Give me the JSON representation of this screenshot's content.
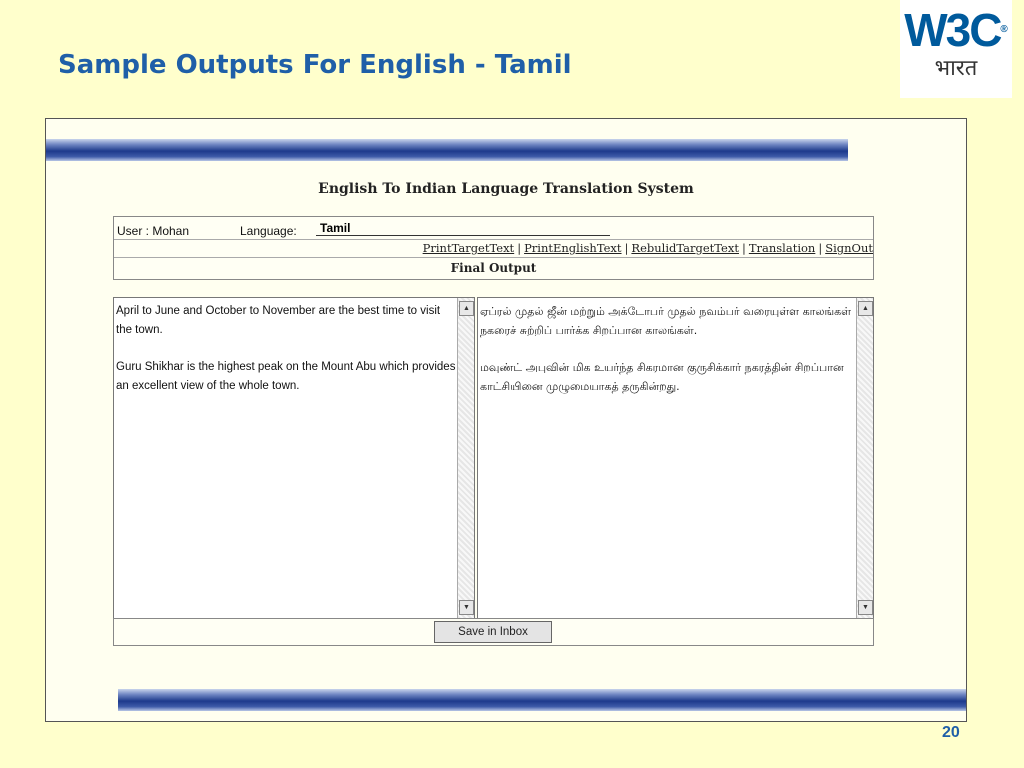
{
  "slide": {
    "title": "Sample Outputs For English - Tamil",
    "page_number": "20"
  },
  "logo": {
    "text": "W3C",
    "registered": "®",
    "subtext": "भारत"
  },
  "app": {
    "title": "English To Indian Language Translation System",
    "user_label": "User : Mohan",
    "language_label": "Language:",
    "language_value": "Tamil",
    "links": [
      "PrintTargetText",
      "PrintEnglishText",
      "RebulidTargetText",
      "Translation",
      "SignOut"
    ],
    "final_output_label": "Final Output",
    "english_text": [
      "April to June and October to November are the best time to visit the town.",
      "Guru Shikhar is the highest peak on the Mount Abu which provides an excellent view of the whole town."
    ],
    "tamil_text": [
      "ஏப்ரல் முதல் ஜீன் மற்றும் அக்டோபர் முதல் நவம்பர் வரையுள்ள காலங்கள் நகரைச் சுற்றிப் பார்க்க சிறப்பான காலங்கள்.",
      "மவுண்ட் அபுவின் மிக உயர்ந்த சிகரமான குருசிக்கார் நகரத்தின் சிறப்பான காட்சியினை முழுமையாகத் தருகின்றது."
    ],
    "save_button": "Save in Inbox"
  }
}
